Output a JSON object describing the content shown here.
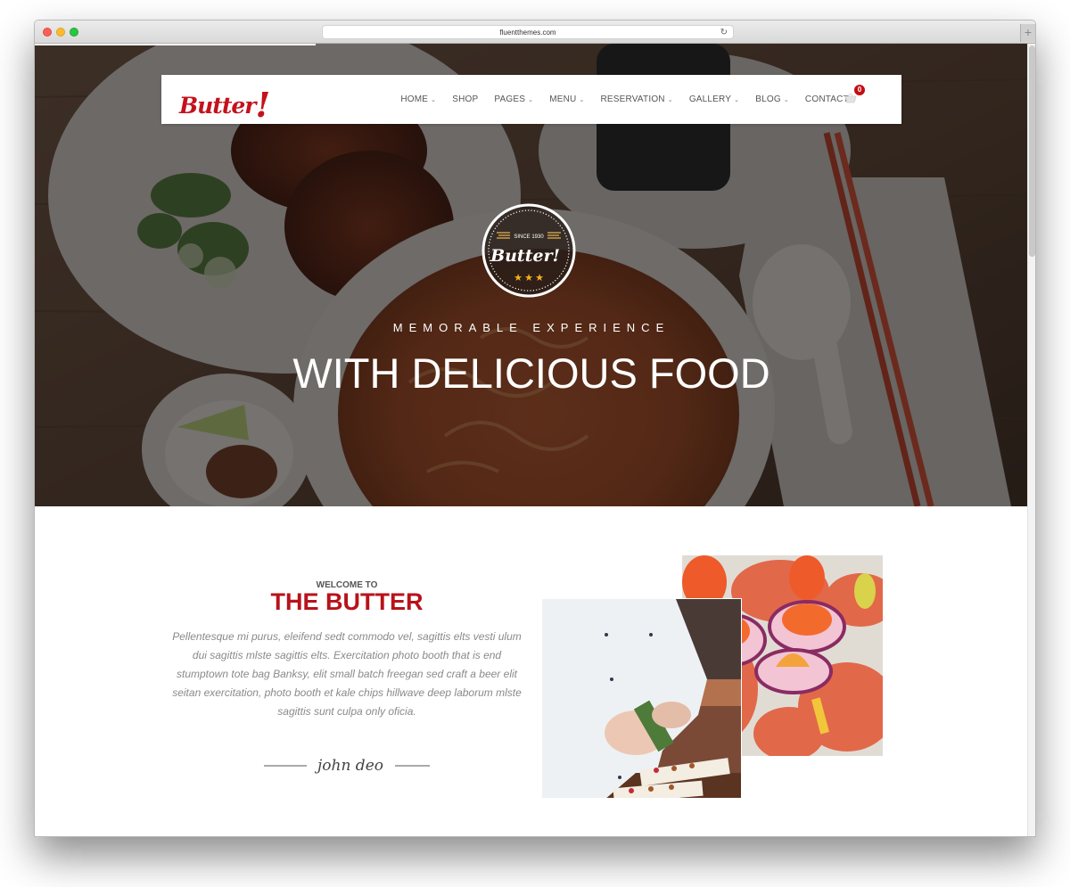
{
  "browser": {
    "url": "fluentthemes.com",
    "reload_icon": "reload-icon",
    "new_tab_icon": "plus-icon",
    "new_tab_label": "+",
    "reload_glyph": "↻",
    "page_load_progress": 0.28
  },
  "header": {
    "logo_text": "Butter",
    "logo_bang": "!",
    "nav": [
      {
        "label": "HOME",
        "has_dropdown": true
      },
      {
        "label": "SHOP",
        "has_dropdown": false
      },
      {
        "label": "PAGES",
        "has_dropdown": true
      },
      {
        "label": "MENU",
        "has_dropdown": true
      },
      {
        "label": "RESERVATION",
        "has_dropdown": true
      },
      {
        "label": "GALLERY",
        "has_dropdown": true
      },
      {
        "label": "BLOG",
        "has_dropdown": true
      },
      {
        "label": "CONTACT",
        "has_dropdown": true
      }
    ],
    "chevron_glyph": "⌄",
    "cart": {
      "icon": "basket-icon",
      "count": "0"
    }
  },
  "hero": {
    "badge": {
      "since": "SINCE 1930",
      "name": "Butter!",
      "stars": 3
    },
    "subtitle": "MEMORABLE EXPERIENCE",
    "title": "WITH DELICIOUS FOOD"
  },
  "about": {
    "welcome": "WELCOME TO",
    "title": "THE BUTTER",
    "text": "Pellentesque mi purus, eleifend sedt commodo vel, sagittis elts vesti ulum dui sagittis mlste sagittis elts. Exercitation photo booth that is end stumptown tote bag Banksy, elit small batch freegan sed craft a beer elit seitan exercitation, photo booth et kale chips hillwave deep laborum mlste sagittis sunt culpa only oficia.",
    "signature": "john deo"
  },
  "colors": {
    "brand_red": "#c4121c",
    "title_red": "#b8121a",
    "star_gold": "#f3b21b",
    "body_gray": "#8a8a8a"
  }
}
